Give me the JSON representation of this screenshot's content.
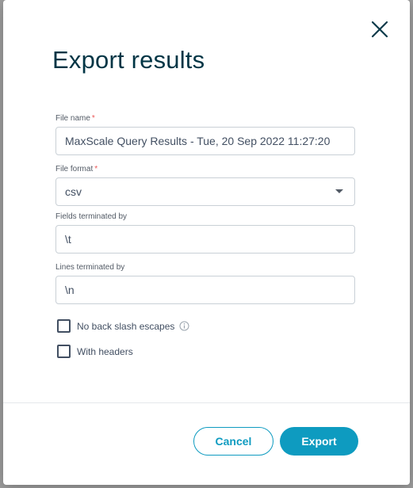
{
  "dialog": {
    "title": "Export results",
    "close_icon": "close-icon"
  },
  "form": {
    "file_name": {
      "label": "File name",
      "required_mark": "*",
      "value": "MaxScale Query Results - Tue, 20 Sep 2022 11:27:20"
    },
    "file_format": {
      "label": "File format",
      "required_mark": "*",
      "value": "csv"
    },
    "fields_terminated": {
      "label": "Fields terminated by",
      "value": "\\t"
    },
    "lines_terminated": {
      "label": "Lines terminated by",
      "value": "\\n"
    },
    "no_backslash": {
      "label": "No back slash escapes",
      "checked": false,
      "info_icon": "info-icon"
    },
    "with_headers": {
      "label": "With headers",
      "checked": false
    }
  },
  "footer": {
    "cancel_label": "Cancel",
    "export_label": "Export"
  },
  "colors": {
    "primary": "#0e9bc0",
    "title": "#003545",
    "required": "#eb5757"
  }
}
